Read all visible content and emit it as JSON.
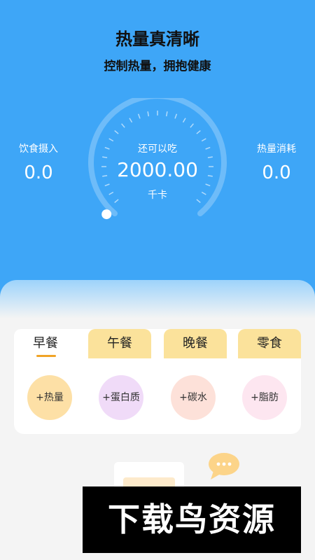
{
  "header": {
    "title": "热量真清晰",
    "subtitle": "控制热量，拥抱健康"
  },
  "stats": {
    "intake": {
      "label": "饮食摄入",
      "value": "0.0"
    },
    "burned": {
      "label": "热量消耗",
      "value": "0.0"
    }
  },
  "gauge": {
    "label": "还可以吃",
    "value": "2000.00",
    "unit": "千卡",
    "progress": 0
  },
  "meals": {
    "tabs": [
      {
        "label": "早餐"
      },
      {
        "label": "午餐"
      },
      {
        "label": "晚餐"
      },
      {
        "label": "零食"
      }
    ],
    "active_tab": 0,
    "actions": [
      {
        "label": "+热量"
      },
      {
        "label": "+蛋白质"
      },
      {
        "label": "+碳水"
      },
      {
        "label": "+脂肪"
      }
    ]
  },
  "watermark": {
    "text": "下载鸟资源"
  },
  "colors": {
    "hero": "#3ea6f7",
    "tab_inactive": "#fbe29b",
    "tab_indicator": "#f0a326",
    "calorie_btn": "#fde0a6",
    "protein_btn": "#f0dbf8",
    "carb_btn": "#fde1d9",
    "fat_btn": "#fde6f0"
  },
  "icons": {
    "chat": "chat-bubble-icon"
  }
}
